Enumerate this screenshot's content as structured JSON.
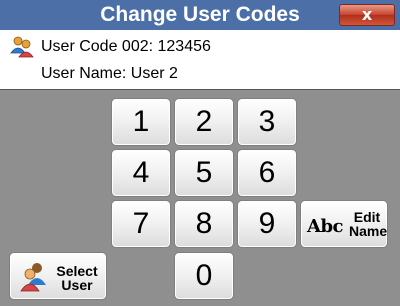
{
  "window": {
    "title": "Change User Codes",
    "close_label": "x"
  },
  "info": {
    "code_line": "User Code 002: 123456",
    "name_line": "User Name: User 2",
    "icon": "users-icon"
  },
  "keypad": {
    "keys": [
      "1",
      "2",
      "3",
      "4",
      "5",
      "6",
      "7",
      "8",
      "9",
      "0"
    ]
  },
  "edit_name_button": {
    "icon_text": "Abc",
    "label_line1": "Edit",
    "label_line2": "Name",
    "icon": "abc-text-icon"
  },
  "select_user_button": {
    "label_line1": "Select",
    "label_line2": "User",
    "icon": "select-user-icon"
  },
  "colors": {
    "titlebar": "#4c6fa8",
    "background": "#8f8f8f",
    "close": "#c8412c"
  }
}
